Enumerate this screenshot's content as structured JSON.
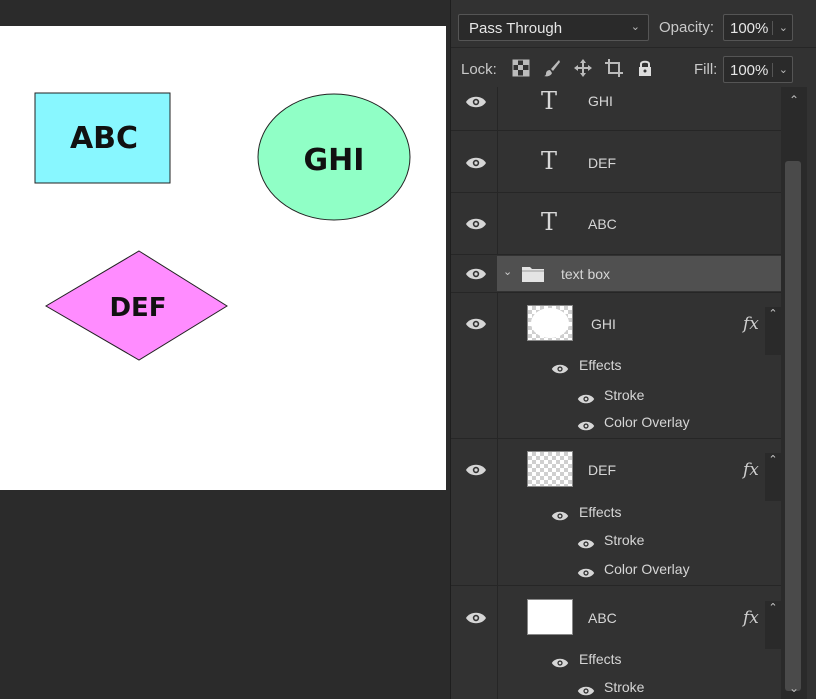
{
  "canvas": {
    "shapes": [
      {
        "label": "ABC",
        "fill": "#88f7ff"
      },
      {
        "label": "GHI",
        "fill": "#90ffc6"
      },
      {
        "label": "DEF",
        "fill": "#ff8cff"
      }
    ]
  },
  "panel": {
    "blend_mode": "Pass Through",
    "opacity_label": "Opacity:",
    "opacity_value": "100%",
    "lock_label": "Lock:",
    "fill_label": "Fill:",
    "fill_value": "100%"
  },
  "layers": {
    "text_layers": [
      "GHI",
      "DEF",
      "ABC"
    ],
    "text_icon": "T",
    "group": {
      "name": "text box",
      "expanded": true
    },
    "shape_layers": [
      {
        "name": "GHI",
        "fx": "fx",
        "effects_label": "Effects",
        "effects": [
          "Stroke",
          "Color Overlay"
        ]
      },
      {
        "name": "DEF",
        "fx": "fx",
        "effects_label": "Effects",
        "effects": [
          "Stroke",
          "Color Overlay"
        ]
      },
      {
        "name": "ABC",
        "fx": "fx",
        "effects_label": "Effects",
        "effects": [
          "Stroke"
        ]
      }
    ]
  },
  "colors": {
    "panel_bg": "#323232",
    "selected_row": "#505050"
  }
}
